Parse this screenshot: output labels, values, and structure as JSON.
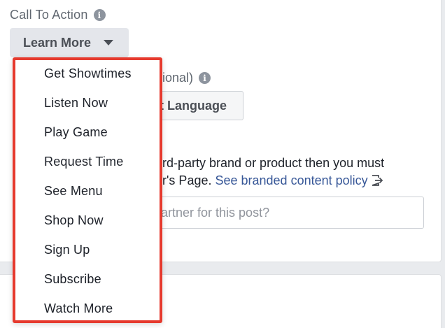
{
  "call_to_action": {
    "label": "Call To Action",
    "selected": "Learn More"
  },
  "language": {
    "label_partial": "ional)",
    "button_partial": "t Language"
  },
  "branded_content": {
    "line1_partial": "rd-party brand or product then you must",
    "line2_partial": "r's Page. ",
    "link": "See branded content policy"
  },
  "partner_input": {
    "placeholder_partial": "artner for this post?"
  },
  "dropdown": {
    "items": [
      "Get Showtimes",
      "Listen Now",
      "Play Game",
      "Request Time",
      "See Menu",
      "Shop Now",
      "Sign Up",
      "Subscribe",
      "Watch More"
    ],
    "highlight_color": "#e63a2e"
  },
  "icons": {
    "info": "info-icon",
    "caret": "caret-down-icon",
    "exit": "exit-link-icon"
  },
  "colors": {
    "link": "#385898",
    "muted": "#606770"
  }
}
